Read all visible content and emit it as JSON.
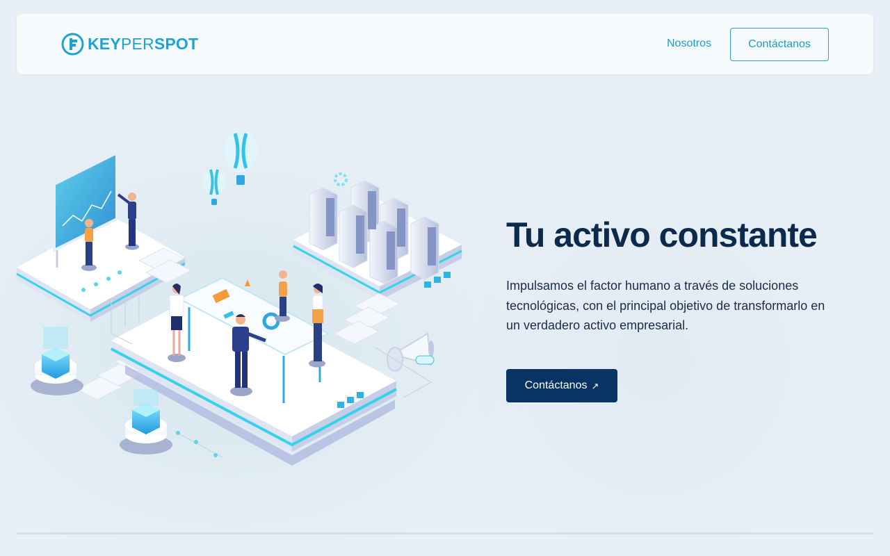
{
  "header": {
    "logo": {
      "part1": "KEY",
      "part2": "PER",
      "part3": "SPOT",
      "icon": "keyperspot-logo-icon"
    },
    "nav": {
      "about_label": "Nosotros",
      "contact_label": "Contáctanos"
    }
  },
  "hero": {
    "title": "Tu activo constante",
    "description": "Impulsamos el factor humano a través de soluciones tecnológicas, con el principal objetivo de transformarlo en un verdadero activo empresarial.",
    "cta_label": "Contáctanos",
    "cta_icon": "arrow-up-right-icon",
    "illustration": "isometric-team-illustration"
  },
  "colors": {
    "brand_blue": "#1ba3d6",
    "navy": "#073463",
    "title": "#0c2a4b",
    "background": "#e8eff6"
  }
}
